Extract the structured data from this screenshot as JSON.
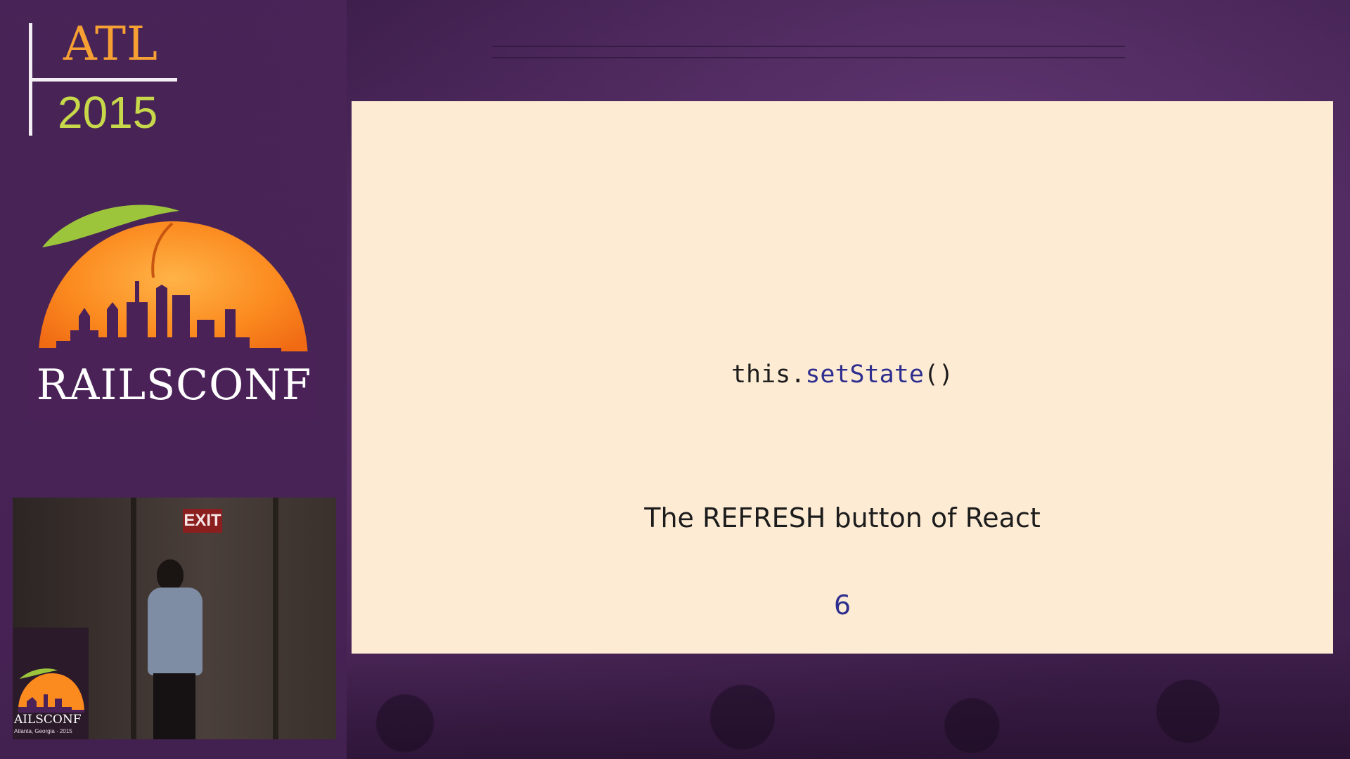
{
  "badge": {
    "city": "ATL",
    "year": "2015"
  },
  "logo": {
    "wordmark": "RAILSCONF"
  },
  "camera": {
    "exit_sign": "EXIT",
    "podium_wordmark": "AILSCONF",
    "podium_subtitle": "Atlanta, Georgia · 2015"
  },
  "slide": {
    "code_prefix": "this.",
    "code_method": "setState",
    "code_suffix": "()",
    "caption": "The REFRESH button of React",
    "page_number": "6"
  },
  "colors": {
    "atl_orange": "#f6a033",
    "year_green": "#c7d94a",
    "slide_background": "#fdebd4",
    "method_blue": "#2e2e8f",
    "panel_purple": "#4a2458"
  }
}
